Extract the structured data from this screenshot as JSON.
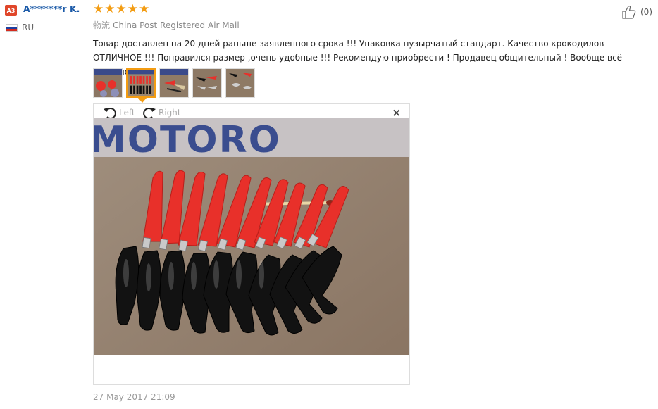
{
  "reviewer": {
    "badge": "A3",
    "name": "A*******r K.",
    "country": "RU"
  },
  "rating": {
    "stars": 5,
    "max": 5
  },
  "helpful": {
    "count": "(0)"
  },
  "shipping": {
    "label": "物流",
    "method": "China Post Registered Air Mail"
  },
  "review": {
    "text": "Товар доставлен на 20 дней раньше заявленного срока !!! Упаковка пузырчатый стандарт. Качество крокодилов ОТЛИЧНОЕ !!! Понравился размер ,очень удобные !!! Рекомендую приобрести ! Продавец общительный ! Вообще всё отлично."
  },
  "thumbnails": {
    "count": 5,
    "active_index": 1
  },
  "viewer": {
    "rotate_left": "Left",
    "rotate_right": "Right",
    "close": "×",
    "photo_banner_text": "MOTORO"
  },
  "date": "27 May 2017 21:09",
  "colors": {
    "accent": "#f39c12",
    "username": "#1b5aa8",
    "badge": "#e0462a",
    "clip_red": "#e8302a",
    "clip_black": "#121212"
  }
}
